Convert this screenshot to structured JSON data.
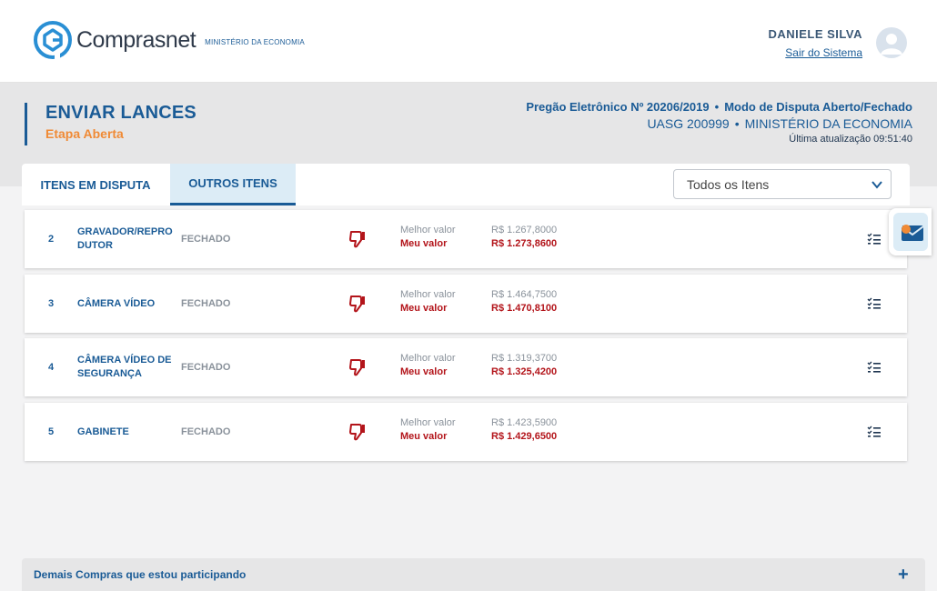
{
  "header": {
    "logo_text": "Comprasnet",
    "logo_subtitle": "MINISTÉRIO DA ECONOMIA",
    "user_name": "DANIELE SILVA",
    "logout_label": "Sair do Sistema",
    "accent": "#1a5b96"
  },
  "page": {
    "title": "ENVIAR LANCES",
    "subtitle": "Etapa Aberta",
    "subtitle_color": "#f08a35",
    "pregao": "Pregão Eletrônico Nº 20206/2019",
    "separator": "•",
    "modo": "Modo de Disputa Aberto/Fechado",
    "uasg": "UASG 200999",
    "orgao": "MINISTÉRIO DA ECONOMIA",
    "updated": "Última atualização 09:51:40"
  },
  "tabs": [
    {
      "label": "ITENS EM DISPUTA",
      "active": false
    },
    {
      "label": "OUTROS ITENS",
      "active": true
    }
  ],
  "filter": {
    "selected": "Todos os Itens"
  },
  "items": [
    {
      "number": "2",
      "description": "GRAVADOR/REPRO DUTOR",
      "status": "FECHADO",
      "best_label": "Melhor valor",
      "mine_label": "Meu valor",
      "best_value": "R$ 1.267,8000",
      "mine_value": "R$ 1.273,8600"
    },
    {
      "number": "3",
      "description": "CÂMERA VÍDEO",
      "status": "FECHADO",
      "best_label": "Melhor valor",
      "mine_label": "Meu valor",
      "best_value": "R$ 1.464,7500",
      "mine_value": "R$ 1.470,8100"
    },
    {
      "number": "4",
      "description": "CÂMERA VÍDEO DE SEGURANÇA",
      "status": "FECHADO",
      "best_label": "Melhor valor",
      "mine_label": "Meu valor",
      "best_value": "R$ 1.319,3700",
      "mine_value": "R$ 1.325,4200"
    },
    {
      "number": "5",
      "description": "GABINETE",
      "status": "FECHADO",
      "best_label": "Melhor valor",
      "mine_label": "Meu valor",
      "best_value": "R$ 1.423,5900",
      "mine_value": "R$ 1.429,6500"
    }
  ],
  "footer": {
    "label": "Demais Compras que estou participando",
    "toggle": "+"
  },
  "icons": {
    "thumb": "thumbs-down-icon",
    "list": "checklist-icon",
    "mail": "mail-icon",
    "negative_color": "#b3141a"
  }
}
